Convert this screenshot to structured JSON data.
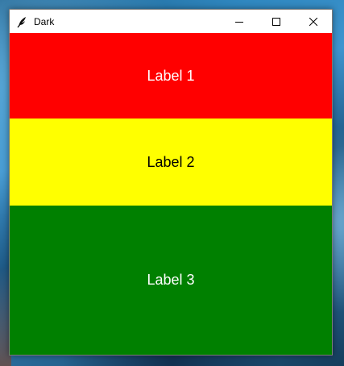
{
  "window": {
    "title": "Dark",
    "icon": "feather-icon",
    "controls": {
      "minimize_icon": "minimize-icon",
      "maximize_icon": "maximize-icon",
      "close_icon": "close-icon"
    }
  },
  "labels": [
    {
      "text": "Label 1",
      "background": "#ff0000",
      "color": "#ffffff"
    },
    {
      "text": "Label 2",
      "background": "#ffff00",
      "color": "#000000"
    },
    {
      "text": "Label 3",
      "background": "#008000",
      "color": "#ffffff"
    }
  ]
}
